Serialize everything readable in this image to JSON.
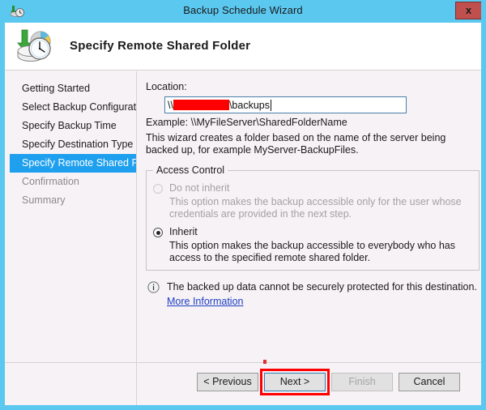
{
  "window": {
    "title": "Backup Schedule Wizard",
    "close_label": "x",
    "titlebar_color": "#5BC8F0",
    "border_color": "#5BC8F0",
    "background_color": "#F7F2F5"
  },
  "header": {
    "title": "Specify Remote Shared Folder",
    "icon": "backup-disk-clock-icon"
  },
  "sidebar": {
    "items": [
      {
        "label": "Getting Started",
        "state": "done"
      },
      {
        "label": "Select Backup Configurat...",
        "state": "done"
      },
      {
        "label": "Specify Backup Time",
        "state": "done"
      },
      {
        "label": "Specify Destination Type",
        "state": "done"
      },
      {
        "label": "Specify Remote Shared F...",
        "state": "selected"
      },
      {
        "label": "Confirmation",
        "state": "future"
      },
      {
        "label": "Summary",
        "state": "future"
      }
    ],
    "selected_color": "#1FA0EF"
  },
  "main": {
    "location_label": "Location:",
    "location_value_prefix": "\\\\",
    "location_value_suffix": "\\backups",
    "location_redacted": true,
    "redaction_color": "#FF0000",
    "example_text": "Example: \\\\MyFileServer\\SharedFolderName",
    "description": "This wizard creates a folder based on the name of the server being backed up, for example MyServer-BackupFiles.",
    "access_control": {
      "legend": "Access Control",
      "options": [
        {
          "label": "Do not inherit",
          "description": "This option makes the backup accessible only for the user whose credentials are provided in the next step.",
          "selected": false,
          "enabled": false
        },
        {
          "label": "Inherit",
          "description": "This option makes the backup accessible to everybody who has access to the specified remote shared folder.",
          "selected": true,
          "enabled": true
        }
      ]
    },
    "notice": {
      "icon": "info-icon",
      "text": "The backed up data cannot be securely protected for this destination.",
      "link_label": "More Information",
      "link_color": "#1d3fc4"
    }
  },
  "footer": {
    "previous_label": "< Previous",
    "next_label": "Next >",
    "finish_label": "Finish",
    "cancel_label": "Cancel",
    "finish_enabled": false,
    "next_focused": true,
    "annotation_color": "#FF0000"
  }
}
